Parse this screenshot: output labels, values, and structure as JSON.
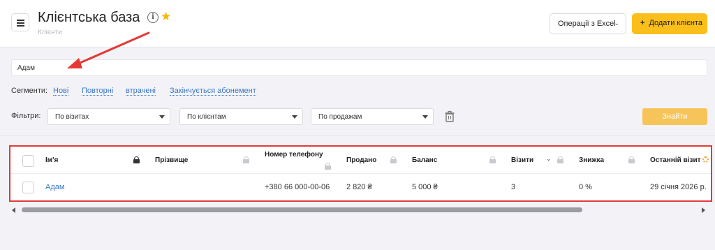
{
  "header": {
    "title": "Клієнтська база",
    "breadcrumb": "Клієнти",
    "excel_button": "Операції з Excel",
    "add_button": "Додати клієнта",
    "info_icon": "info-icon",
    "star_icon": "star-icon"
  },
  "search": {
    "value": "Адам"
  },
  "segments": {
    "label": "Сегменти:",
    "items": [
      "Нові",
      "Повторні",
      "втрачені",
      "Закінчується абонемент"
    ]
  },
  "filters": {
    "label": "Фільтри:",
    "selects": [
      "По візитах",
      "По клієнтам",
      "По продажам"
    ],
    "find_button": "Знайти"
  },
  "table": {
    "columns": [
      "Ім'я",
      "Прізвище",
      "Номер телефону",
      "Продано",
      "Баланс",
      "Візити",
      "Знижка",
      "Останній візит"
    ],
    "rows": [
      {
        "name": "Адам",
        "surname": "",
        "phone": "+380 66 000-00-06",
        "sold": "2 820 ₴",
        "balance": "5 000 ₴",
        "visits": "3",
        "discount": "0 %",
        "last_visit": "29 січня 2026 р."
      }
    ]
  },
  "colors": {
    "accent": "#fbbf1b",
    "link": "#3a78c9",
    "annotation": "#e53935"
  }
}
